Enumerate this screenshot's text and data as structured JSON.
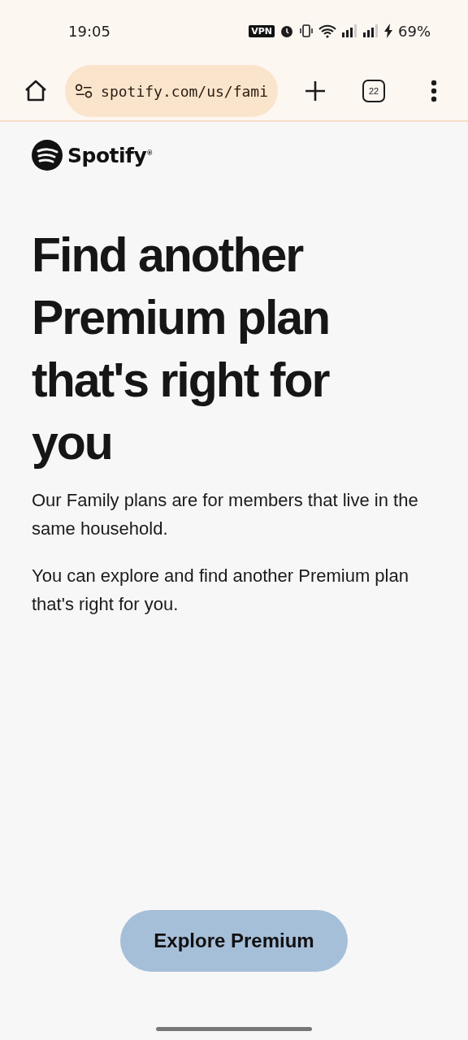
{
  "status_bar": {
    "time": "19:05",
    "vpn": "VPN",
    "battery": "69%"
  },
  "browser": {
    "url": "spotify.com/us/fami",
    "tab_count": "22"
  },
  "brand": {
    "name": "Spotify$^{®}$"
  },
  "heading": "Find another Premium plan that's right for you",
  "paragraphs": [
    "Our Family plans are for members that live in the same household.",
    "You can explore and find another Premium plan that's right for you."
  ],
  "button": {
    "label": "Explore Premium"
  }
}
